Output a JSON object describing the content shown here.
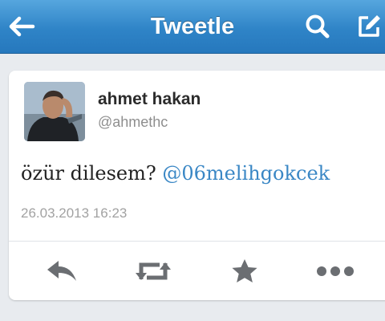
{
  "navbar": {
    "title": "Tweetle",
    "back_icon": "back-arrow-icon",
    "search_icon": "search-icon",
    "compose_icon": "compose-icon"
  },
  "tweet": {
    "author_name": "ahmet hakan",
    "author_handle": "@ahmethc",
    "text": "özür dilesem?",
    "mention": "@06melihgokcek",
    "timestamp": "26.03.2013 16:23"
  },
  "actions": {
    "reply_icon": "reply-icon",
    "retweet_icon": "retweet-icon",
    "favorite_icon": "star-icon",
    "more_icon": "more-icon"
  },
  "colors": {
    "nav_bar": "#2f84c7",
    "mention": "#3a87c5",
    "icon_gray": "#6b6e72"
  }
}
